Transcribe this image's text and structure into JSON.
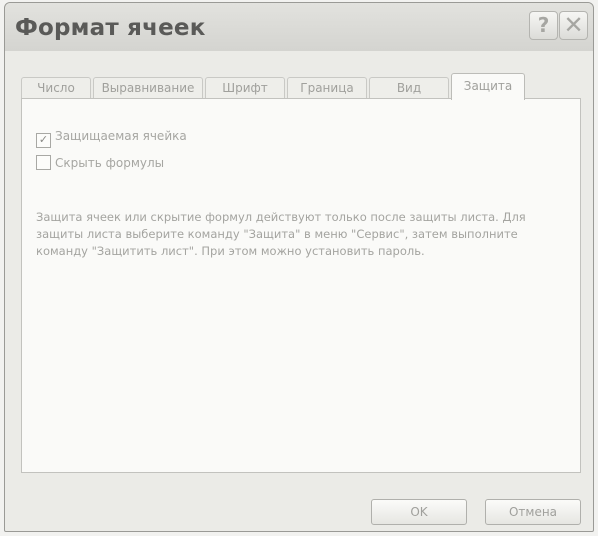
{
  "window": {
    "title": "Формат ячеек",
    "help_label": "?",
    "close_label": "✕"
  },
  "tabs": [
    {
      "label": "Число",
      "active": false
    },
    {
      "label": "Выравнивание",
      "active": false
    },
    {
      "label": "Шрифт",
      "active": false
    },
    {
      "label": "Граница",
      "active": false
    },
    {
      "label": "Вид",
      "active": false
    },
    {
      "label": "Защита",
      "active": true
    }
  ],
  "protection": {
    "locked_label": "Защищаемая ячейка",
    "locked_checked": true,
    "hidden_label": "Скрыть формулы",
    "hidden_checked": false,
    "check_mark": "✓",
    "info_text": "Защита ячеек или скрытие формул действуют только после защиты листа. Для защиты листа выберите команду \"Защита\" в меню \"Сервис\", затем выполните команду \"Защитить лист\". При этом можно установить пароль."
  },
  "buttons": {
    "ok": "OK",
    "cancel": "Отмена"
  }
}
